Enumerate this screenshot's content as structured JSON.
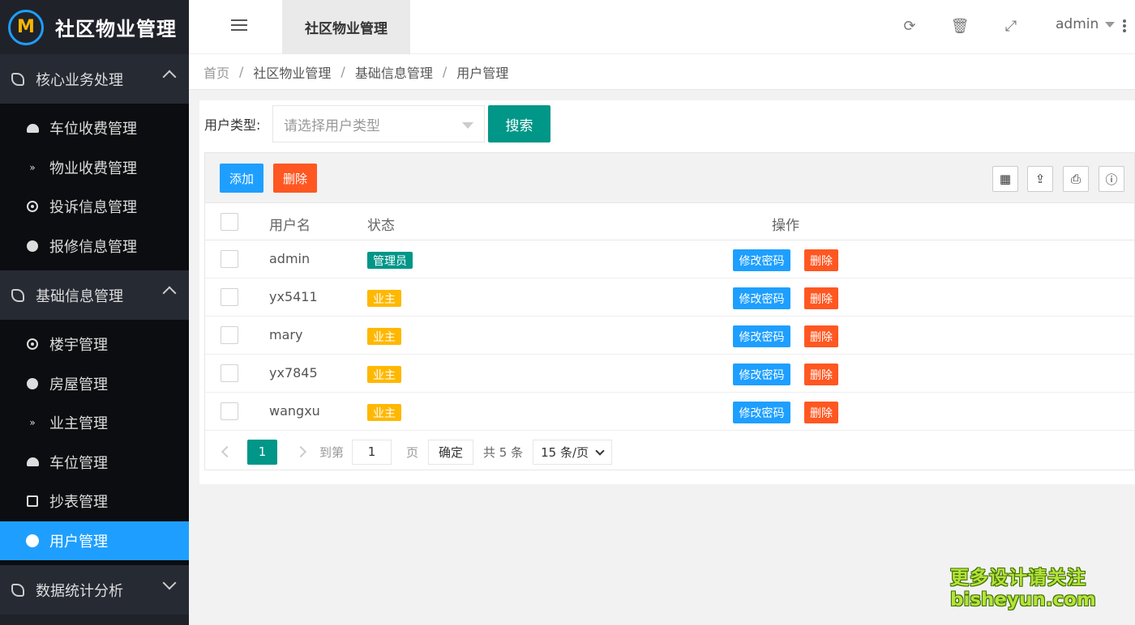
{
  "app": {
    "title": "社区物业管理"
  },
  "sidebar": {
    "groups": [
      {
        "label": "核心业务处理",
        "items": [
          "车位收费管理",
          "物业收费管理",
          "投诉信息管理",
          "报修信息管理"
        ]
      },
      {
        "label": "基础信息管理",
        "items": [
          "楼宇管理",
          "房屋管理",
          "业主管理",
          "车位管理",
          "抄表管理",
          "用户管理"
        ]
      },
      {
        "label": "数据统计分析",
        "items": []
      }
    ]
  },
  "header": {
    "active_tab": "社区物业管理",
    "user": "admin"
  },
  "breadcrumb": [
    "首页",
    "社区物业管理",
    "基础信息管理",
    "用户管理"
  ],
  "search": {
    "label": "用户类型:",
    "placeholder": "请选择用户类型",
    "button": "搜索"
  },
  "toolbar": {
    "add": "添加",
    "delete": "删除"
  },
  "table": {
    "headers": {
      "name": "用户名",
      "status": "状态",
      "op": "操作"
    },
    "rows": [
      {
        "name": "admin",
        "status": "管理员"
      },
      {
        "name": "yx5411",
        "status": "业主"
      },
      {
        "name": "mary",
        "status": "业主"
      },
      {
        "name": "yx7845",
        "status": "业主"
      },
      {
        "name": "wangxu",
        "status": "业主"
      }
    ],
    "op_pwd": "修改密码",
    "op_del": "删除"
  },
  "pager": {
    "current": "1",
    "goto": "到第",
    "page_input": "1",
    "page": "页",
    "confirm": "确定",
    "total": "共 5 条",
    "page_size": "15 条/页"
  },
  "watermark": {
    "line1": "更多设计请关注",
    "line2": "bisheyun.com"
  },
  "colors": {
    "accent": "#009688",
    "blue": "#1e9fff",
    "danger": "#ff5722",
    "warn": "#ffb800",
    "sidebar": "#20222a"
  }
}
